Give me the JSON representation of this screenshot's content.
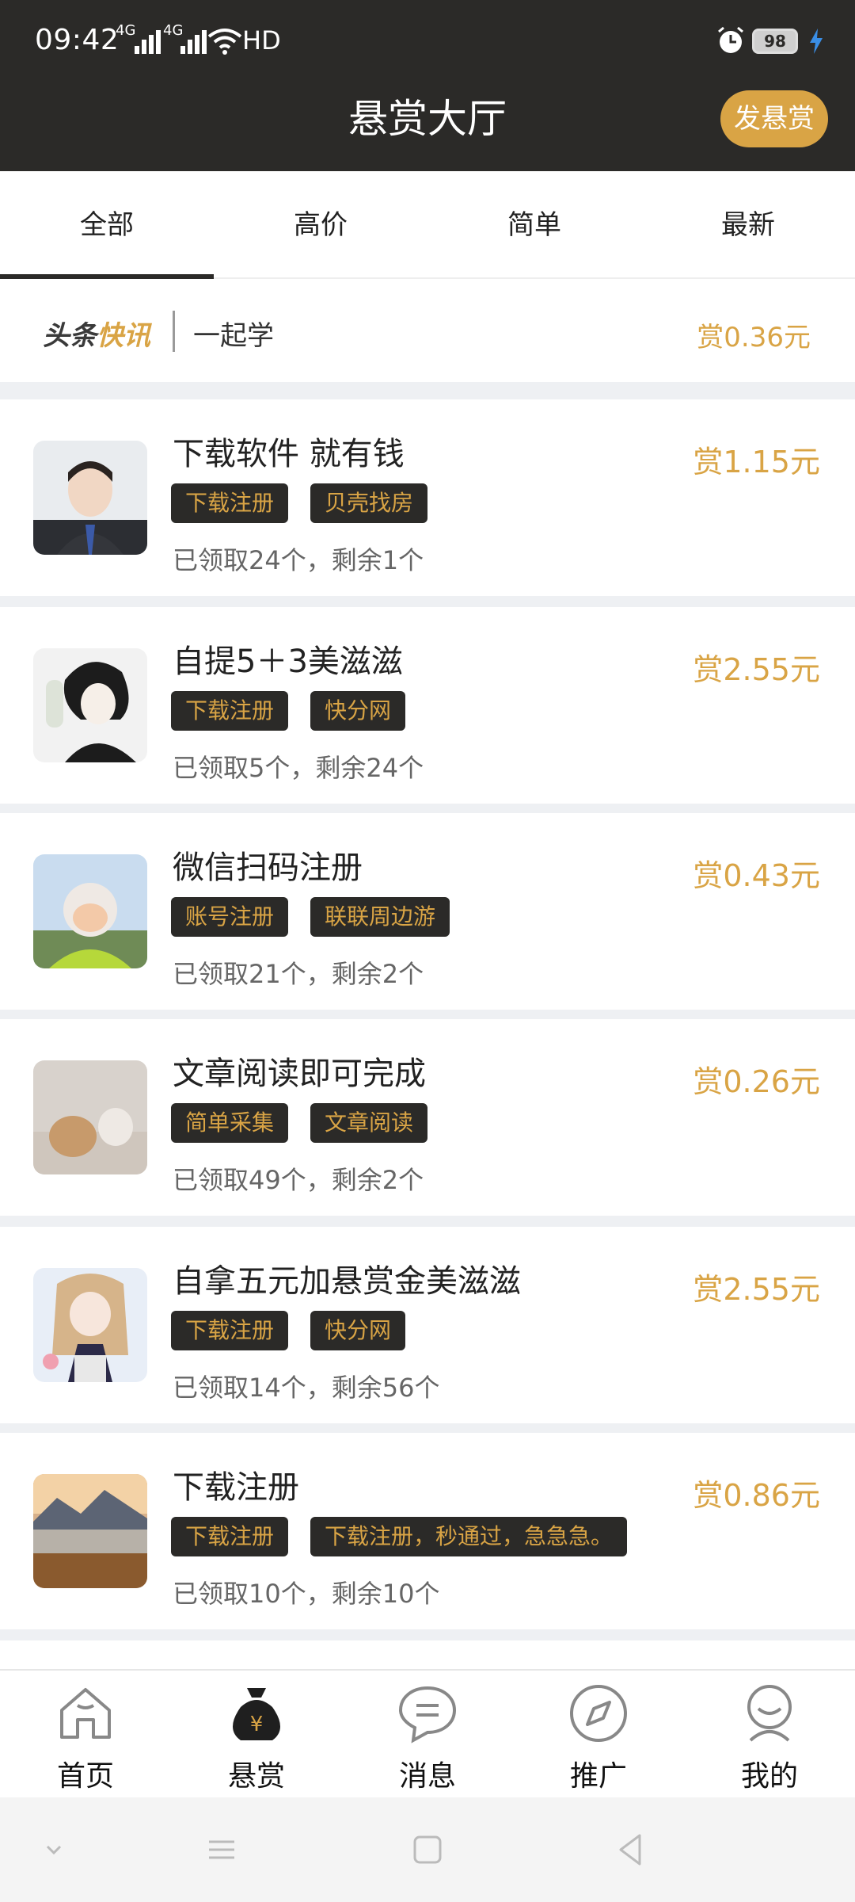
{
  "status_bar": {
    "time": "09:42",
    "sig1": "4G",
    "sig2": "4G",
    "hd": "HD",
    "battery": "98"
  },
  "header": {
    "title": "悬赏大厅",
    "post_button": "发悬赏"
  },
  "tabs": [
    "全部",
    "高价",
    "简单",
    "最新"
  ],
  "news": {
    "brand_part1": "头条",
    "brand_part2": "快讯",
    "text": "一起学",
    "reward": "赏0.36元"
  },
  "tasks": [
    {
      "title": "下载软件 就有钱",
      "tags": [
        "下载注册",
        "贝壳找房"
      ],
      "meta": "已领取24个，剩余1个",
      "reward": "赏1.15元"
    },
    {
      "title": "自提5＋3美滋滋",
      "tags": [
        "下载注册",
        "快分网"
      ],
      "meta": "已领取5个，剩余24个",
      "reward": "赏2.55元"
    },
    {
      "title": "微信扫码注册",
      "tags": [
        "账号注册",
        "联联周边游"
      ],
      "meta": "已领取21个，剩余2个",
      "reward": "赏0.43元"
    },
    {
      "title": "文章阅读即可完成",
      "tags": [
        "简单采集",
        "文章阅读"
      ],
      "meta": "已领取49个，剩余2个",
      "reward": "赏0.26元"
    },
    {
      "title": "自拿五元加悬赏金美滋滋",
      "tags": [
        "下载注册",
        "快分网"
      ],
      "meta": "已领取14个，剩余56个",
      "reward": "赏2.55元"
    },
    {
      "title": "下载注册",
      "tags": [
        "下载注册",
        "下载注册，秒通过，急急急。"
      ],
      "meta": "已领取10个，剩余10个",
      "reward": "赏0.86元"
    }
  ],
  "bottom_nav": [
    "首页",
    "悬赏",
    "消息",
    "推广",
    "我的"
  ],
  "colors": {
    "header_bg": "#2b2a28",
    "accent_gold": "#d9a445",
    "separator": "#eef0f3"
  },
  "icons": [
    "home-icon",
    "money-bag-icon",
    "chat-icon",
    "compass-icon",
    "profile-icon"
  ]
}
